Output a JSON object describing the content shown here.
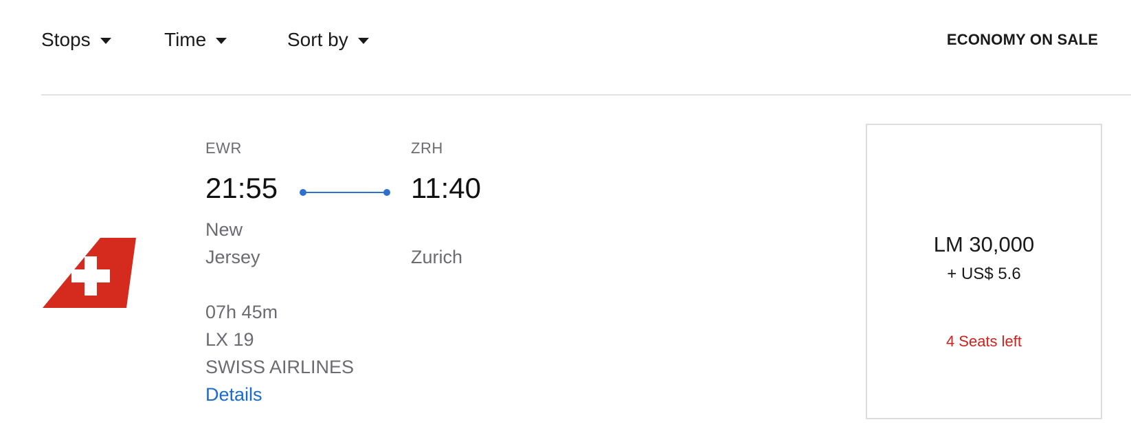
{
  "filters": {
    "stops_label": "Stops",
    "time_label": "Time",
    "sort_label": "Sort by"
  },
  "cabin": {
    "label": "ECONOMY ON SALE"
  },
  "flight": {
    "origin": {
      "code": "EWR",
      "time": "21:55",
      "city": "New Jersey"
    },
    "destination": {
      "code": "ZRH",
      "time": "11:40",
      "city": "Zurich"
    },
    "duration": "07h 45m",
    "flight_number": "LX 19",
    "airline": "SWISS AIRLINES",
    "details_label": "Details",
    "airline_logo_icon": "swiss-tail-logo-icon"
  },
  "fare": {
    "miles": "LM 30,000",
    "cash": "+ US$ 5.6",
    "seats_left": "4 Seats left"
  },
  "colors": {
    "accent_link": "#1a6bd1",
    "route_line": "#2f6fce",
    "alert": "#d0211c",
    "swiss_red": "#d52b1e"
  }
}
